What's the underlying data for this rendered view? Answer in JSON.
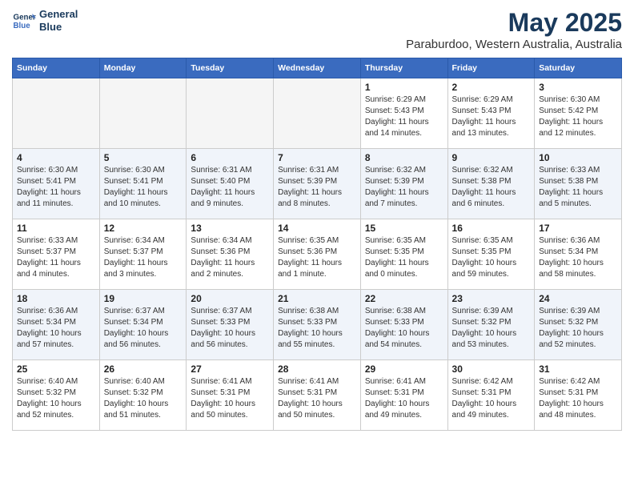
{
  "header": {
    "logo_line1": "General",
    "logo_line2": "Blue",
    "main_title": "May 2025",
    "subtitle": "Paraburdoo, Western Australia, Australia"
  },
  "days_of_week": [
    "Sunday",
    "Monday",
    "Tuesday",
    "Wednesday",
    "Thursday",
    "Friday",
    "Saturday"
  ],
  "weeks": [
    [
      {
        "day": "",
        "info": "",
        "empty": true
      },
      {
        "day": "",
        "info": "",
        "empty": true
      },
      {
        "day": "",
        "info": "",
        "empty": true
      },
      {
        "day": "",
        "info": "",
        "empty": true
      },
      {
        "day": "1",
        "info": "Sunrise: 6:29 AM\nSunset: 5:43 PM\nDaylight: 11 hours\nand 14 minutes.",
        "empty": false
      },
      {
        "day": "2",
        "info": "Sunrise: 6:29 AM\nSunset: 5:43 PM\nDaylight: 11 hours\nand 13 minutes.",
        "empty": false
      },
      {
        "day": "3",
        "info": "Sunrise: 6:30 AM\nSunset: 5:42 PM\nDaylight: 11 hours\nand 12 minutes.",
        "empty": false
      }
    ],
    [
      {
        "day": "4",
        "info": "Sunrise: 6:30 AM\nSunset: 5:41 PM\nDaylight: 11 hours\nand 11 minutes.",
        "empty": false
      },
      {
        "day": "5",
        "info": "Sunrise: 6:30 AM\nSunset: 5:41 PM\nDaylight: 11 hours\nand 10 minutes.",
        "empty": false
      },
      {
        "day": "6",
        "info": "Sunrise: 6:31 AM\nSunset: 5:40 PM\nDaylight: 11 hours\nand 9 minutes.",
        "empty": false
      },
      {
        "day": "7",
        "info": "Sunrise: 6:31 AM\nSunset: 5:39 PM\nDaylight: 11 hours\nand 8 minutes.",
        "empty": false
      },
      {
        "day": "8",
        "info": "Sunrise: 6:32 AM\nSunset: 5:39 PM\nDaylight: 11 hours\nand 7 minutes.",
        "empty": false
      },
      {
        "day": "9",
        "info": "Sunrise: 6:32 AM\nSunset: 5:38 PM\nDaylight: 11 hours\nand 6 minutes.",
        "empty": false
      },
      {
        "day": "10",
        "info": "Sunrise: 6:33 AM\nSunset: 5:38 PM\nDaylight: 11 hours\nand 5 minutes.",
        "empty": false
      }
    ],
    [
      {
        "day": "11",
        "info": "Sunrise: 6:33 AM\nSunset: 5:37 PM\nDaylight: 11 hours\nand 4 minutes.",
        "empty": false
      },
      {
        "day": "12",
        "info": "Sunrise: 6:34 AM\nSunset: 5:37 PM\nDaylight: 11 hours\nand 3 minutes.",
        "empty": false
      },
      {
        "day": "13",
        "info": "Sunrise: 6:34 AM\nSunset: 5:36 PM\nDaylight: 11 hours\nand 2 minutes.",
        "empty": false
      },
      {
        "day": "14",
        "info": "Sunrise: 6:35 AM\nSunset: 5:36 PM\nDaylight: 11 hours\nand 1 minute.",
        "empty": false
      },
      {
        "day": "15",
        "info": "Sunrise: 6:35 AM\nSunset: 5:35 PM\nDaylight: 11 hours\nand 0 minutes.",
        "empty": false
      },
      {
        "day": "16",
        "info": "Sunrise: 6:35 AM\nSunset: 5:35 PM\nDaylight: 10 hours\nand 59 minutes.",
        "empty": false
      },
      {
        "day": "17",
        "info": "Sunrise: 6:36 AM\nSunset: 5:34 PM\nDaylight: 10 hours\nand 58 minutes.",
        "empty": false
      }
    ],
    [
      {
        "day": "18",
        "info": "Sunrise: 6:36 AM\nSunset: 5:34 PM\nDaylight: 10 hours\nand 57 minutes.",
        "empty": false
      },
      {
        "day": "19",
        "info": "Sunrise: 6:37 AM\nSunset: 5:34 PM\nDaylight: 10 hours\nand 56 minutes.",
        "empty": false
      },
      {
        "day": "20",
        "info": "Sunrise: 6:37 AM\nSunset: 5:33 PM\nDaylight: 10 hours\nand 56 minutes.",
        "empty": false
      },
      {
        "day": "21",
        "info": "Sunrise: 6:38 AM\nSunset: 5:33 PM\nDaylight: 10 hours\nand 55 minutes.",
        "empty": false
      },
      {
        "day": "22",
        "info": "Sunrise: 6:38 AM\nSunset: 5:33 PM\nDaylight: 10 hours\nand 54 minutes.",
        "empty": false
      },
      {
        "day": "23",
        "info": "Sunrise: 6:39 AM\nSunset: 5:32 PM\nDaylight: 10 hours\nand 53 minutes.",
        "empty": false
      },
      {
        "day": "24",
        "info": "Sunrise: 6:39 AM\nSunset: 5:32 PM\nDaylight: 10 hours\nand 52 minutes.",
        "empty": false
      }
    ],
    [
      {
        "day": "25",
        "info": "Sunrise: 6:40 AM\nSunset: 5:32 PM\nDaylight: 10 hours\nand 52 minutes.",
        "empty": false
      },
      {
        "day": "26",
        "info": "Sunrise: 6:40 AM\nSunset: 5:32 PM\nDaylight: 10 hours\nand 51 minutes.",
        "empty": false
      },
      {
        "day": "27",
        "info": "Sunrise: 6:41 AM\nSunset: 5:31 PM\nDaylight: 10 hours\nand 50 minutes.",
        "empty": false
      },
      {
        "day": "28",
        "info": "Sunrise: 6:41 AM\nSunset: 5:31 PM\nDaylight: 10 hours\nand 50 minutes.",
        "empty": false
      },
      {
        "day": "29",
        "info": "Sunrise: 6:41 AM\nSunset: 5:31 PM\nDaylight: 10 hours\nand 49 minutes.",
        "empty": false
      },
      {
        "day": "30",
        "info": "Sunrise: 6:42 AM\nSunset: 5:31 PM\nDaylight: 10 hours\nand 49 minutes.",
        "empty": false
      },
      {
        "day": "31",
        "info": "Sunrise: 6:42 AM\nSunset: 5:31 PM\nDaylight: 10 hours\nand 48 minutes.",
        "empty": false
      }
    ]
  ]
}
